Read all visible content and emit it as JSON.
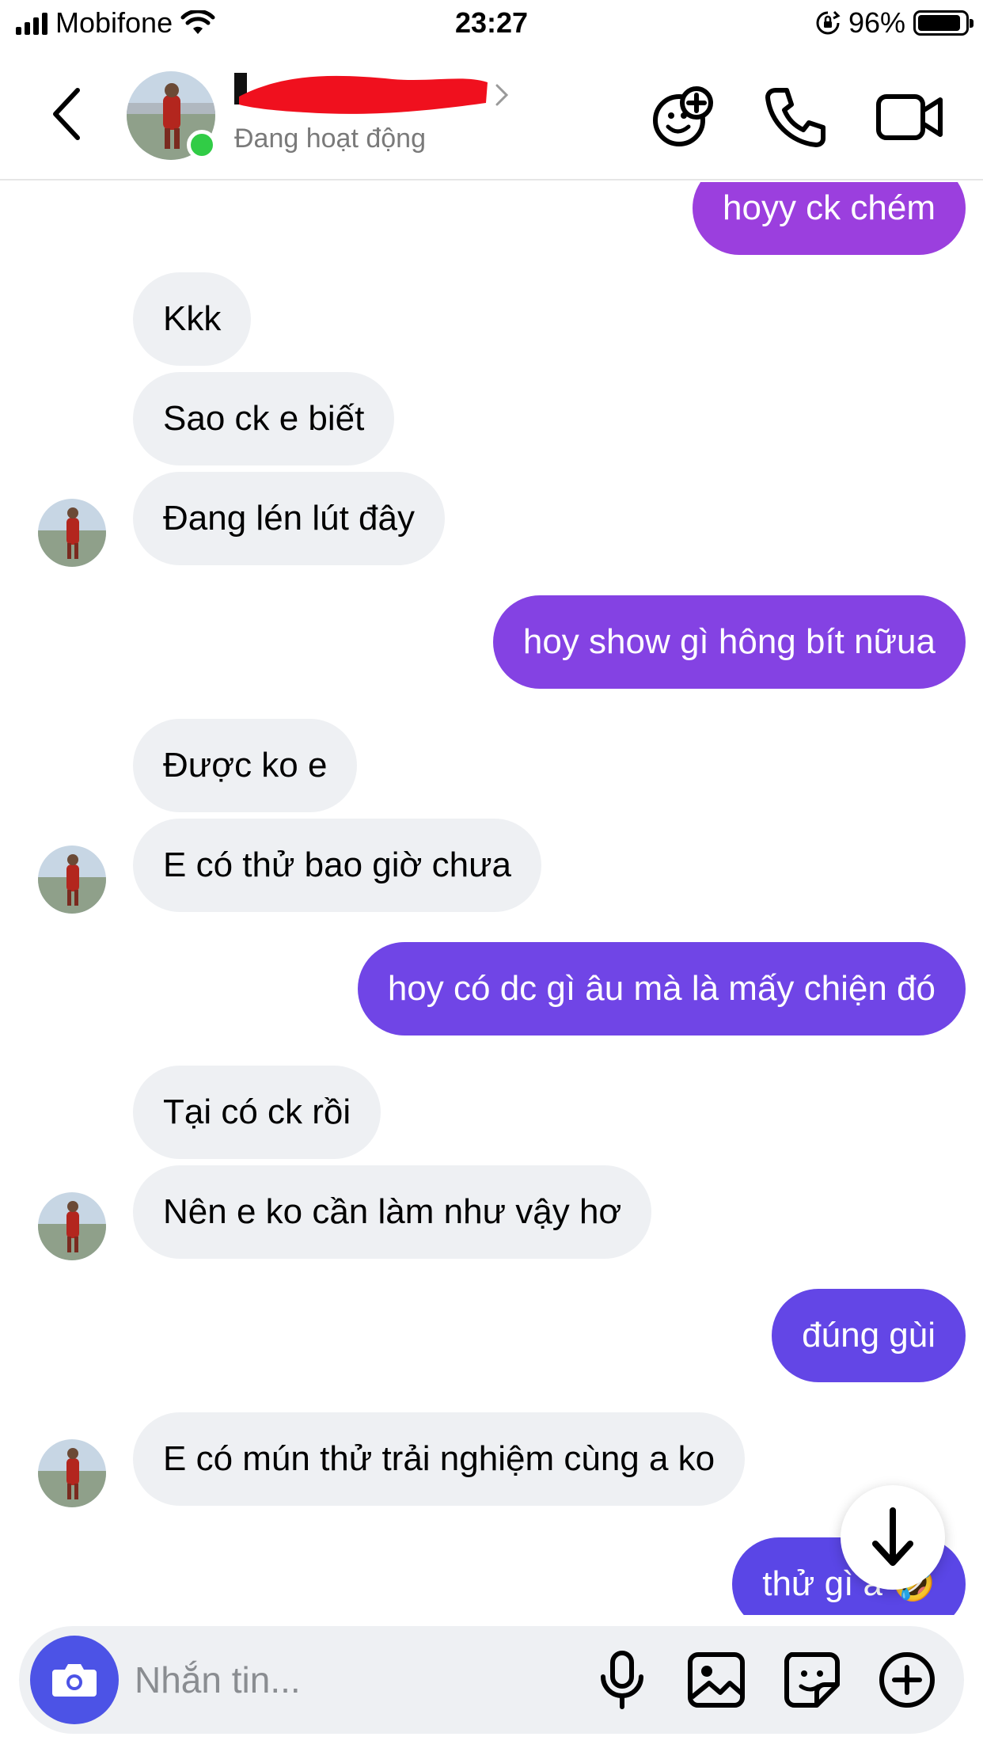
{
  "status_bar": {
    "carrier": "Mobifone",
    "time": "23:27",
    "battery": "96%",
    "battery_level": 0.96
  },
  "header": {
    "name_redacted": true,
    "status": "Đang hoạt động"
  },
  "colors": {
    "purple_top": "#9b3fde",
    "purple_mid": "#7f45e6",
    "purple_low": "#5f46e6",
    "incoming_bg": "#eef0f3",
    "online": "#31cc46",
    "camera_button": "#4c53e6"
  },
  "messages": [
    {
      "from": "me",
      "text": "hoyy ck chém"
    },
    {
      "from": "them",
      "text": "Kkk"
    },
    {
      "from": "them",
      "text": "Sao ck e biết"
    },
    {
      "from": "them",
      "text": "Đang lén lút đây"
    },
    {
      "from": "me",
      "text": "hoy show gì hông bít nữua"
    },
    {
      "from": "them",
      "text": "Được ko e"
    },
    {
      "from": "them",
      "text": "E có thử bao giờ chưa"
    },
    {
      "from": "me",
      "text": "hoy có dc gì âu mà là mấy chiện đó"
    },
    {
      "from": "them",
      "text": "Tại có ck rồi"
    },
    {
      "from": "them",
      "text": "Nên e ko cần làm như vậy hơ"
    },
    {
      "from": "me",
      "text": "đúng gùi"
    },
    {
      "from": "them",
      "text": "E có mún thử trải nghiệm cùng a ko"
    },
    {
      "from": "me",
      "text": "thử gì a 🤣"
    }
  ],
  "composer": {
    "placeholder": "Nhắn tin..."
  },
  "icons": {
    "header": [
      "back-chevron-icon",
      "effects-icon",
      "phone-icon",
      "video-camera-icon"
    ],
    "composer": [
      "camera-icon",
      "microphone-icon",
      "gallery-icon",
      "sticker-icon",
      "plus-icon"
    ],
    "floating": "arrow-down-icon"
  }
}
